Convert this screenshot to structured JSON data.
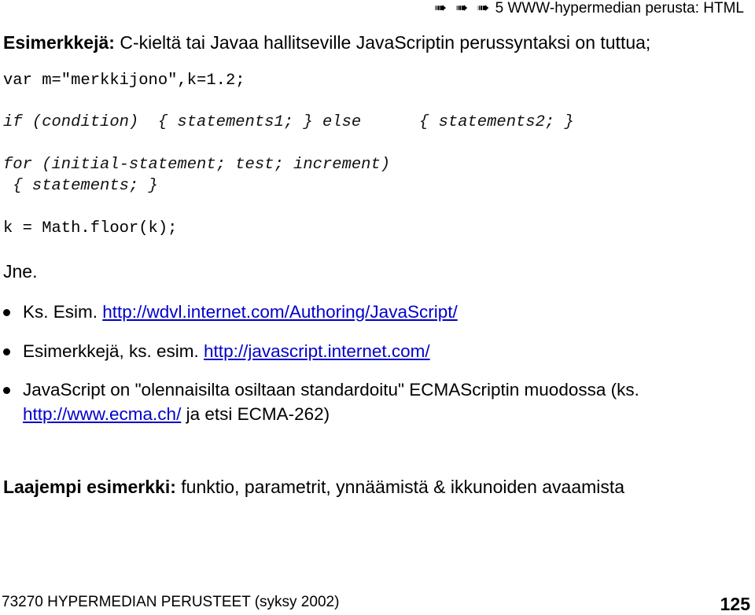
{
  "header": {
    "arrows": "➠ ➠ ➠",
    "title": "5 WWW-hypermedian perusta: HTML"
  },
  "intro": {
    "bold": "Esimerkkejä:",
    "text": " C-kieltä tai Javaa hallitseville JavaScriptin perussyntaksi on tuttua;"
  },
  "code": {
    "line1": "var m=\"merkkijono\",k=1.2;",
    "line2": "if (condition)  { statements1; } else      { statements2; }",
    "line3": "for (initial-statement; test; increment)",
    "line4": " { statements; }",
    "line5": "k = Math.floor(k);"
  },
  "jne": "Jne.",
  "bullets": [
    {
      "prefix": "Ks. Esim. ",
      "link": "http://wdvl.internet.com/Authoring/JavaScript/"
    },
    {
      "prefix": "Esimerkkejä, ks. esim. ",
      "link": "http://javascript.internet.com/"
    },
    {
      "prefix": "JavaScript on \"olennaisilta osiltaan standardoitu\" ECMAScriptin muodossa (ks. ",
      "link": "http://www.ecma.ch/",
      "suffix": " ja etsi ECMA-262)"
    }
  ],
  "wide_example": {
    "bold": "Laajempi esimerkki:",
    "text": " funktio, parametrit, ynnäämistä & ikkunoiden avaamista"
  },
  "footer": {
    "course": "73270 HYPERMEDIAN PERUSTEET (syksy 2002)",
    "page_number": "125"
  },
  "colors": {
    "link": "#0000cc",
    "text": "#000000",
    "background": "#ffffff"
  }
}
